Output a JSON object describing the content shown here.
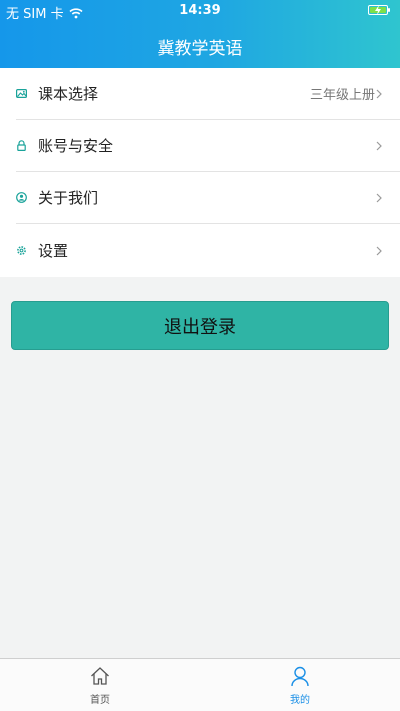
{
  "status_bar": {
    "carrier": "无 SIM 卡",
    "time": "14:39"
  },
  "header": {
    "title": "冀教学英语"
  },
  "menu": [
    {
      "icon": "image-icon",
      "label": "课本选择",
      "value": "三年级上册"
    },
    {
      "icon": "lock-icon",
      "label": "账号与安全"
    },
    {
      "icon": "user-circle-icon",
      "label": "关于我们"
    },
    {
      "icon": "gear-icon",
      "label": "设置"
    }
  ],
  "logout_label": "退出登录",
  "tabs": [
    {
      "icon": "home-icon",
      "label": "首页",
      "active": false
    },
    {
      "icon": "person-icon",
      "label": "我的",
      "active": true
    }
  ],
  "colors": {
    "header_start": "#1597ea",
    "header_end": "#2fc5cf",
    "accent": "#2fb4a5",
    "tab_active": "#1a8fe6",
    "icon_teal": "#1aa39a"
  }
}
